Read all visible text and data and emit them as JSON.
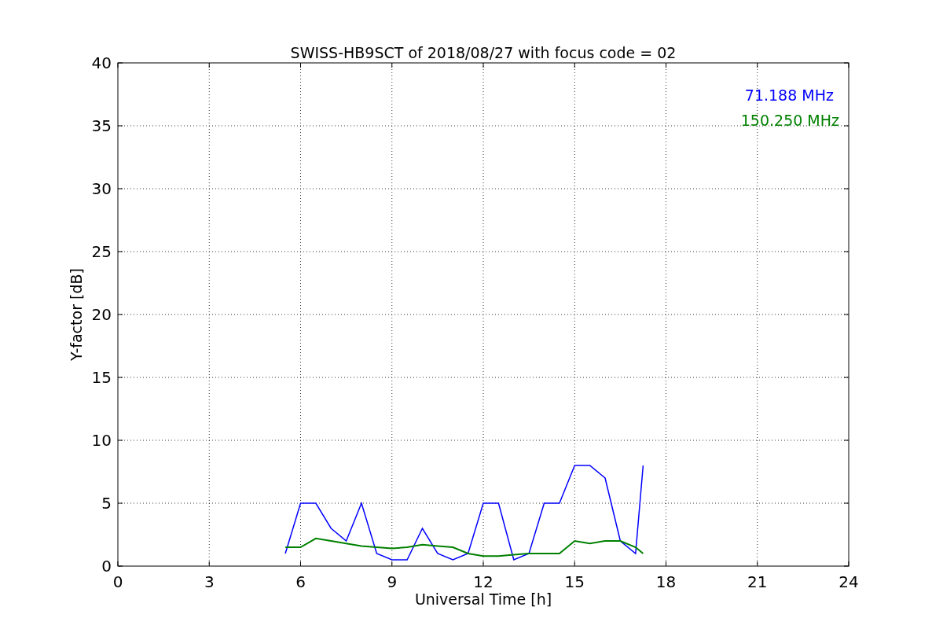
{
  "chart_data": {
    "type": "line",
    "title": "SWISS-HB9SCT of 2018/08/27 with focus code = 02",
    "xlabel": "Universal Time [h]",
    "ylabel": "Y-factor [dB]",
    "x": [
      5.5,
      6,
      6.5,
      7,
      7.5,
      8,
      8.5,
      9,
      9.5,
      10,
      10.5,
      11,
      11.5,
      12,
      12.5,
      13,
      13.5,
      14,
      14.5,
      15,
      15.5,
      16,
      16.5,
      17,
      17.25
    ],
    "series": [
      {
        "name": "71.188 MHz",
        "color": "#0000ff",
        "values": [
          1,
          5,
          5,
          3,
          2,
          5,
          1,
          0.5,
          0.5,
          3,
          1,
          0.5,
          1,
          5,
          5,
          0.5,
          1,
          5,
          5,
          8,
          8,
          7,
          2,
          1,
          8
        ]
      },
      {
        "name": "150.250 MHz",
        "color": "#008000",
        "values": [
          1.5,
          1.5,
          2.2,
          2,
          1.8,
          1.6,
          1.5,
          1.4,
          1.5,
          1.7,
          1.6,
          1.5,
          1,
          0.8,
          0.8,
          0.9,
          1,
          1,
          1,
          2,
          1.8,
          2,
          2,
          1.5,
          1
        ]
      }
    ],
    "grid": true,
    "xlim": [
      0,
      24
    ],
    "ylim": [
      0,
      40
    ],
    "xticks": [
      0,
      3,
      6,
      9,
      12,
      15,
      18,
      21,
      24
    ],
    "yticks": [
      0,
      5,
      10,
      15,
      20,
      25,
      30,
      35,
      40
    ]
  }
}
